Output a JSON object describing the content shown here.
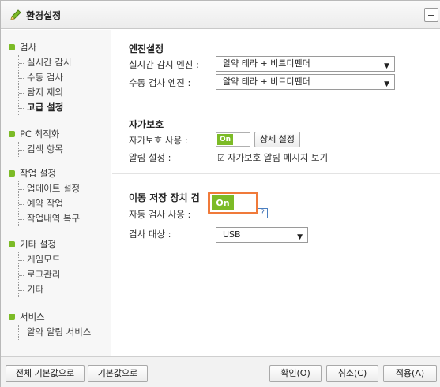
{
  "window": {
    "title": "환경설정"
  },
  "sidebar": {
    "groups": [
      {
        "label": "검사",
        "items": [
          "실시간 감시",
          "수동 검사",
          "탐지 제외",
          "고급 설정"
        ],
        "active": "고급 설정"
      },
      {
        "label": "PC 최적화",
        "items": [
          "검색 항목"
        ]
      },
      {
        "label": "작업 설정",
        "items": [
          "업데이트 설정",
          "예약 작업",
          "작업내역 복구"
        ]
      },
      {
        "label": "기타 설정",
        "items": [
          "게임모드",
          "로그관리",
          "기타"
        ]
      },
      {
        "label": "서비스",
        "items": [
          "알약 알림 서비스"
        ]
      }
    ]
  },
  "engine": {
    "title": "엔진설정",
    "realtime_label": "실시간 감시 엔진 :",
    "realtime_value": "알약 테라 + 비트디펜더",
    "manual_label": "수동 검사 엔진 :",
    "manual_value": "알약 테라 + 비트디펜더"
  },
  "self_protect": {
    "title": "자가보호",
    "use_label": "자가보호 사용 :",
    "toggle_text": "On",
    "detail_button": "상세 설정",
    "alert_label": "알림 설정 :",
    "alert_check_label": "자가보호 알림 메시지 보기"
  },
  "usb": {
    "title": "이동 저장 장치 검",
    "auto_label": "자동 검사 사용 :",
    "toggle_text": "On",
    "help_glyph": "?",
    "target_label": "검사 대상 :",
    "target_value": "USB"
  },
  "footer": {
    "reset_all": "전체 기본값으로",
    "reset": "기본값으로",
    "ok": "확인(O)",
    "cancel": "취소(C)",
    "apply": "적용(A)"
  },
  "colors": {
    "accent_green": "#7cbb26",
    "highlight_orange": "#f07a3a"
  }
}
